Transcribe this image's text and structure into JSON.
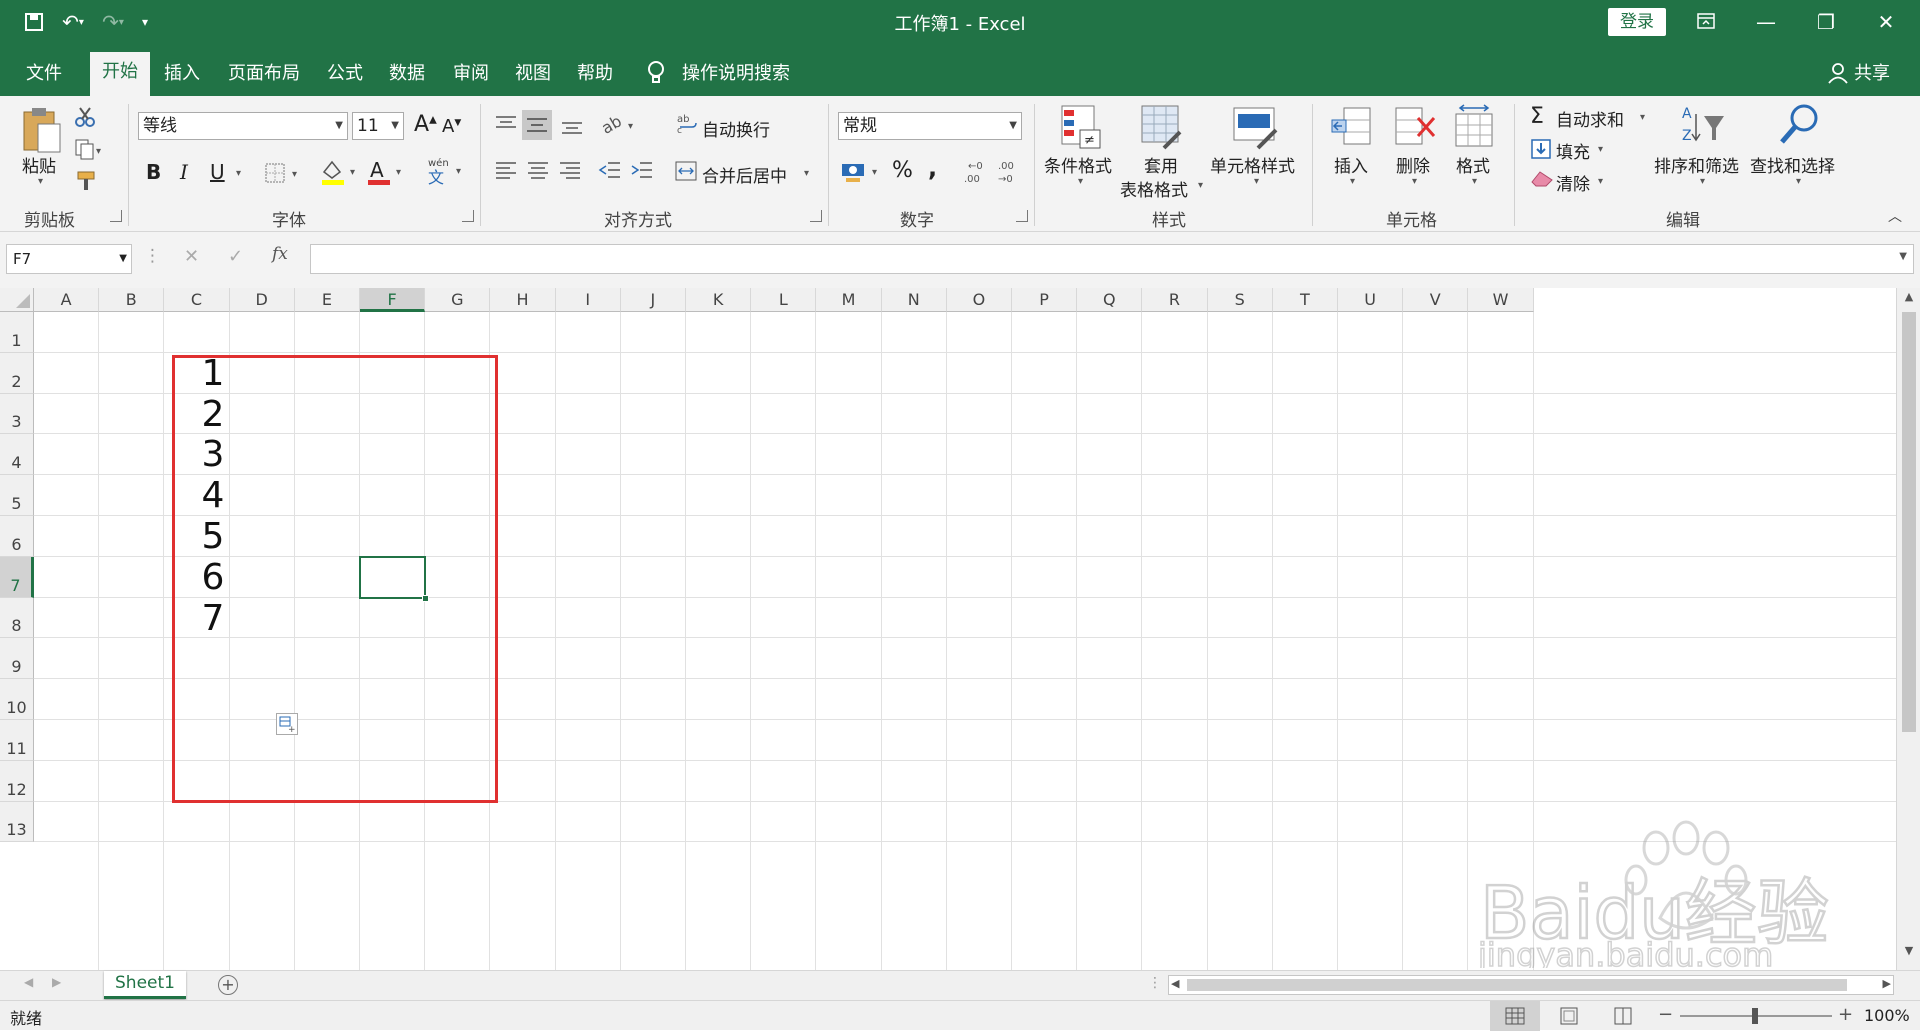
{
  "titlebar": {
    "title": "工作簿1  -  Excel",
    "login": "登录"
  },
  "tabs": [
    "文件",
    "开始",
    "插入",
    "页面布局",
    "公式",
    "数据",
    "审阅",
    "视图",
    "帮助"
  ],
  "active_tab": "开始",
  "tell_me": "操作说明搜索",
  "share": "共享",
  "ribbon": {
    "clipboard": {
      "paste": "粘贴",
      "label": "剪贴板"
    },
    "font": {
      "name": "等线",
      "size": "11",
      "bold": "B",
      "italic": "I",
      "underline": "U",
      "label": "字体",
      "phonetic": "wén\n文"
    },
    "alignment": {
      "wrap": "自动换行",
      "merge": "合并后居中",
      "label": "对齐方式"
    },
    "number": {
      "format": "常规",
      "percent": "%",
      "comma": ",",
      "label": "数字"
    },
    "styles": {
      "conditional": "条件格式",
      "table_line1": "套用",
      "table_line2": "表格格式",
      "cell_styles": "单元格样式",
      "label": "样式"
    },
    "cells": {
      "insert": "插入",
      "delete": "删除",
      "format": "格式",
      "label": "单元格"
    },
    "editing": {
      "autosum": "自动求和",
      "fill": "填充",
      "clear": "清除",
      "sort": "排序和筛选",
      "find": "查找和选择",
      "label": "编辑"
    }
  },
  "formula_bar": {
    "name_box": "F7",
    "fx": "fx",
    "value": ""
  },
  "columns": [
    "A",
    "B",
    "C",
    "D",
    "E",
    "F",
    "G",
    "H",
    "I",
    "J",
    "K",
    "L",
    "M",
    "N",
    "O",
    "P",
    "Q",
    "R",
    "S",
    "T",
    "U",
    "V",
    "W"
  ],
  "rows": [
    "1",
    "2",
    "3",
    "4",
    "5",
    "6",
    "7",
    "8",
    "9",
    "10",
    "11",
    "12",
    "13"
  ],
  "selected_cell": "F7",
  "cells": [
    {
      "ref": "C2",
      "value": "1"
    },
    {
      "ref": "C3",
      "value": "2"
    },
    {
      "ref": "C4",
      "value": "3"
    },
    {
      "ref": "C5",
      "value": "4"
    },
    {
      "ref": "C6",
      "value": "5"
    },
    {
      "ref": "C7",
      "value": "6"
    },
    {
      "ref": "C8",
      "value": "7"
    }
  ],
  "sheets": [
    "Sheet1"
  ],
  "status": {
    "ready": "就绪",
    "zoom": "100%"
  },
  "watermark": {
    "brand": "Baidu经验",
    "url": "jingyan.baidu.com"
  },
  "colors": {
    "excel_green": "#217346",
    "highlight_red": "#e03030"
  }
}
